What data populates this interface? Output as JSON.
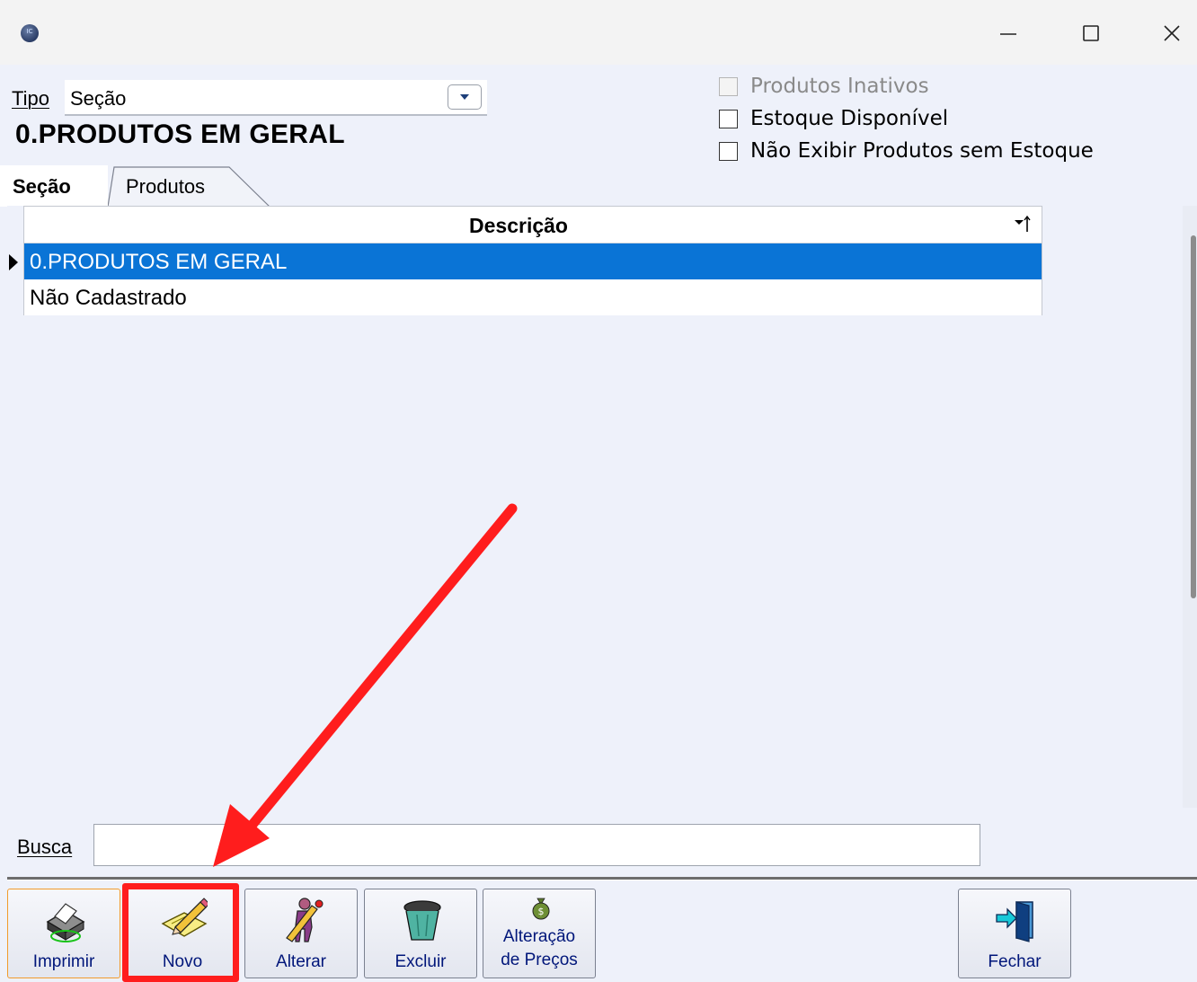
{
  "window": {
    "app_icon_text": "IC",
    "controls": {
      "minimize": "minimize-icon",
      "maximize": "maximize-icon",
      "close": "close-icon"
    }
  },
  "filter": {
    "tipo_label": "Tipo",
    "tipo_value": "Seção",
    "section_heading": "0.PRODUTOS EM GERAL"
  },
  "options": {
    "produtos_inativos": {
      "label": "Produtos Inativos",
      "checked": false,
      "enabled": false
    },
    "estoque_disponivel": {
      "label": "Estoque Disponível",
      "checked": false,
      "enabled": true
    },
    "nao_exibir_sem_estoque": {
      "label": "Não Exibir Produtos sem Estoque",
      "checked": false,
      "enabled": true
    }
  },
  "tabs": [
    {
      "label": "Seção",
      "active": true
    },
    {
      "label": "Produtos",
      "active": false
    }
  ],
  "grid": {
    "columns": [
      "Descrição"
    ],
    "rows": [
      {
        "descricao": "0.PRODUTOS EM GERAL",
        "selected": true
      },
      {
        "descricao": "Não Cadastrado",
        "selected": false
      }
    ]
  },
  "search": {
    "label": "Busca",
    "value": ""
  },
  "toolbar": {
    "imprimir": "Imprimir",
    "novo": "Novo",
    "alterar": "Alterar",
    "excluir": "Excluir",
    "precos_line1": "Alteração",
    "precos_line2": "de Preços",
    "fechar": "Fechar"
  },
  "colors": {
    "selection": "#0a74d6",
    "annotation": "#ff1d1d",
    "button_label": "#00167a",
    "background": "#eef1fa"
  }
}
